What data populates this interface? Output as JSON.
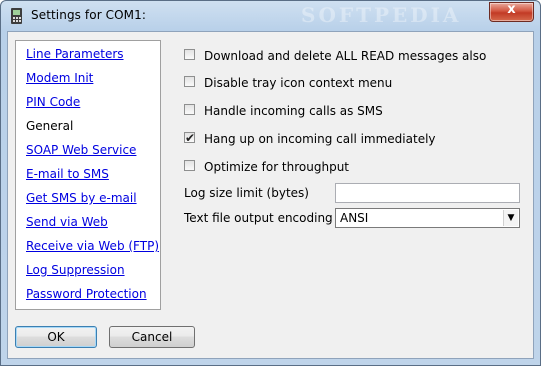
{
  "window": {
    "title": "Settings for COM1:",
    "icon": "phone-settings-icon",
    "close_symbol": "x",
    "watermark": "SOFTPEDIA"
  },
  "sidebar": {
    "items": [
      {
        "label": "Line Parameters",
        "active": false
      },
      {
        "label": "Modem Init",
        "active": false
      },
      {
        "label": "PIN Code",
        "active": false
      },
      {
        "label": "General",
        "active": true
      },
      {
        "label": "SOAP Web Service",
        "active": false
      },
      {
        "label": "E-mail to SMS",
        "active": false
      },
      {
        "label": "Get SMS by e-mail",
        "active": false
      },
      {
        "label": "Send via Web",
        "active": false
      },
      {
        "label": "Receive via Web (FTP)",
        "active": false
      },
      {
        "label": "Log Suppression",
        "active": false
      },
      {
        "label": "Password Protection",
        "active": false
      }
    ]
  },
  "options": [
    {
      "label": "Download and delete ALL READ messages also",
      "checked": false
    },
    {
      "label": "Disable tray icon context menu",
      "checked": false
    },
    {
      "label": "Handle incoming calls as SMS",
      "checked": false
    },
    {
      "label": "Hang up on incoming call immediately",
      "checked": true
    },
    {
      "label": "Optimize for throughput",
      "checked": false
    }
  ],
  "log_size": {
    "label": "Log size limit (bytes)",
    "value": ""
  },
  "encoding": {
    "label": "Text file output encoding",
    "value": "ANSI"
  },
  "buttons": {
    "ok": "OK",
    "cancel": "Cancel"
  }
}
